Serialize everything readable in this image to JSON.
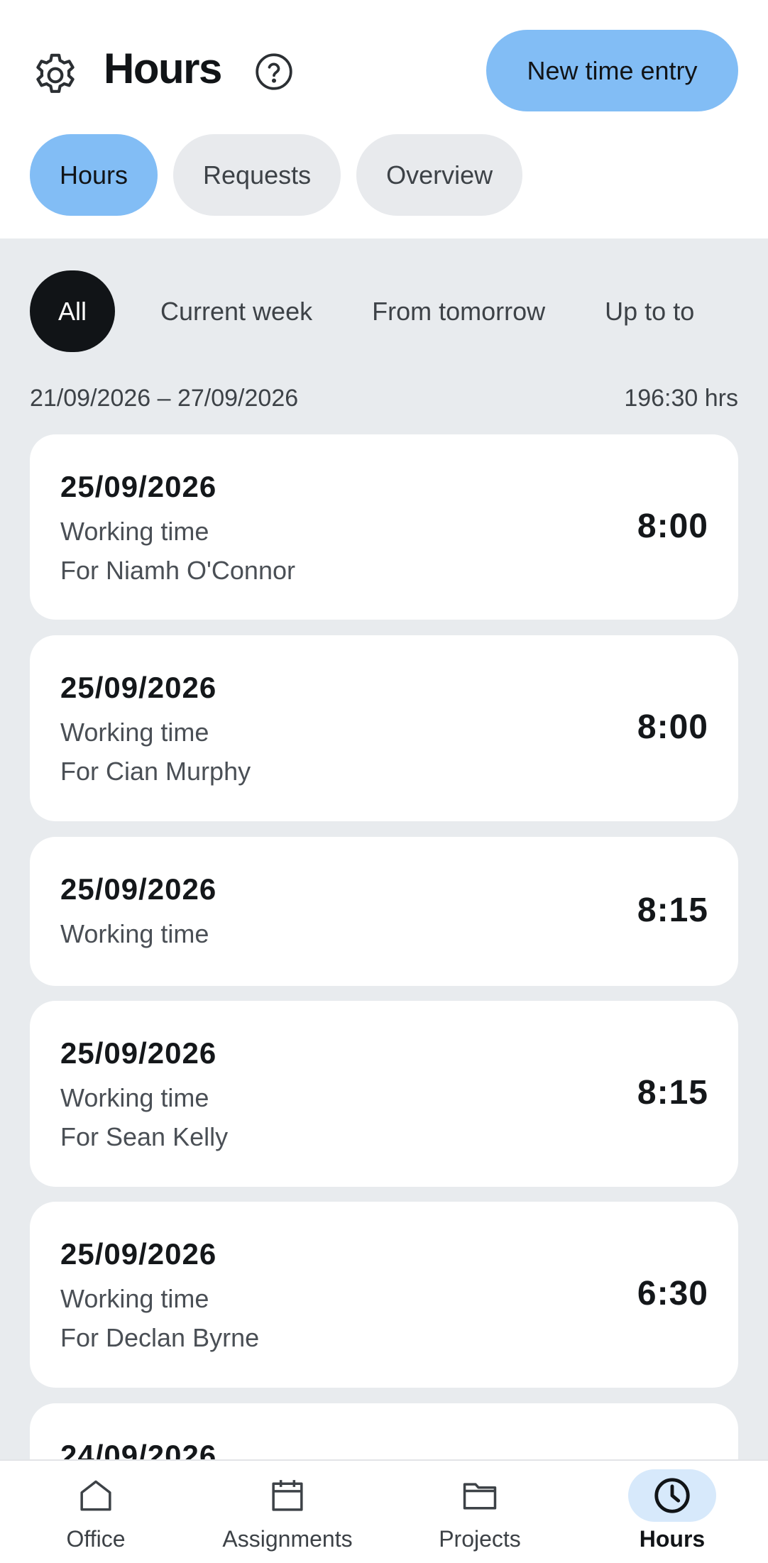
{
  "header": {
    "title": "Hours",
    "new_entry_label": "New time entry",
    "settings_icon": "gear-icon",
    "help_icon": "question-circle-icon"
  },
  "tabs": [
    {
      "label": "Hours",
      "active": true
    },
    {
      "label": "Requests",
      "active": false
    },
    {
      "label": "Overview",
      "active": false
    }
  ],
  "filters": [
    {
      "label": "All",
      "active": true
    },
    {
      "label": "Current week",
      "active": false
    },
    {
      "label": "From tomorrow",
      "active": false
    },
    {
      "label": "Up to to",
      "active": false
    }
  ],
  "summary": {
    "range": "21/09/2026 – 27/09/2026",
    "total": "196:30 hrs"
  },
  "entries": [
    {
      "date": "25/09/2026",
      "type": "Working time",
      "person": "For Niamh O'Connor",
      "hours": "8:00"
    },
    {
      "date": "25/09/2026",
      "type": "Working time",
      "person": "For Cian Murphy",
      "hours": "8:00"
    },
    {
      "date": "25/09/2026",
      "type": "Working time",
      "person": "",
      "hours": "8:15"
    },
    {
      "date": "25/09/2026",
      "type": "Working time",
      "person": "For Sean Kelly",
      "hours": "8:15"
    },
    {
      "date": "25/09/2026",
      "type": "Working time",
      "person": "For Declan Byrne",
      "hours": "6:30"
    },
    {
      "date": "24/09/2026",
      "type": "",
      "person": "",
      "hours": ""
    }
  ],
  "nav": [
    {
      "label": "Office",
      "icon": "home-icon",
      "active": false
    },
    {
      "label": "Assignments",
      "icon": "calendar-icon",
      "active": false
    },
    {
      "label": "Projects",
      "icon": "folder-icon",
      "active": false
    },
    {
      "label": "Hours",
      "icon": "clock-icon",
      "active": true
    }
  ],
  "colors": {
    "accent": "#82bdf5",
    "accent_light": "#d7e9fb",
    "dark_chip": "#111417",
    "content_bg": "#e8ebee",
    "chip_bg": "#e8eaed"
  }
}
